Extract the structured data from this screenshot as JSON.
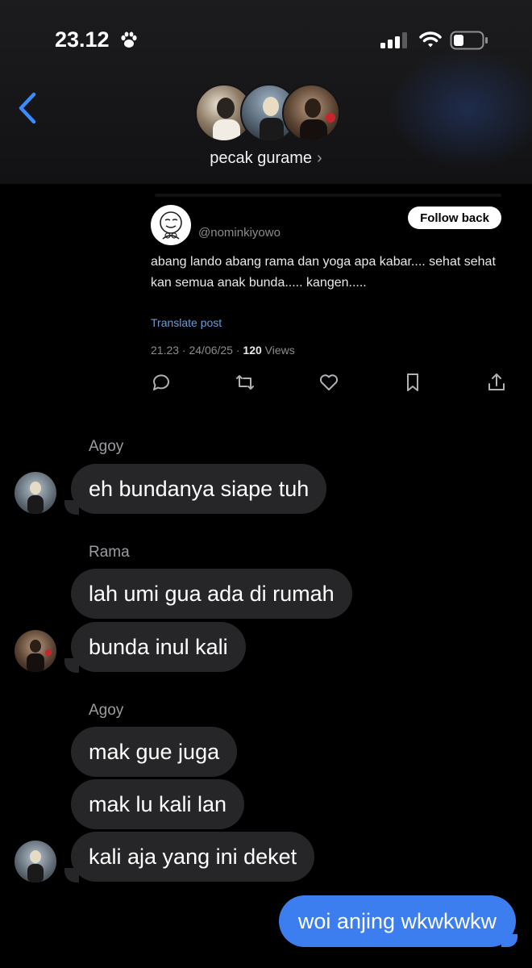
{
  "status_bar": {
    "time": "23.12"
  },
  "header": {
    "group_name": "pecak gurame",
    "chevron": "›"
  },
  "shared_post": {
    "handle": "@nominkiyowo",
    "follow_label": "Follow back",
    "text": "abang lando abang rama dan yoga apa kabar.... sehat sehat kan semua anak bunda..... kangen.....",
    "translate_label": "Translate post",
    "timestamp": "21.23 · 24/06/25 · ",
    "views_count": "120",
    "views_label": " Views"
  },
  "messages": {
    "g1_sender": "Agoy",
    "g1_m1": "eh bundanya siape tuh",
    "g2_sender": "Rama",
    "g2_m1": "lah umi gua ada di rumah",
    "g2_m2": "bunda inul kali",
    "g3_sender": "Agoy",
    "g3_m1": "mak gue juga",
    "g3_m2": "mak lu kali lan",
    "g3_m3": "kali aja yang ini deket",
    "outgoing": "woi anjing wkwkwkw"
  },
  "colors": {
    "accent_blue": "#3c7ef0",
    "incoming_bubble": "#262628",
    "back_chevron": "#3a8bff"
  }
}
